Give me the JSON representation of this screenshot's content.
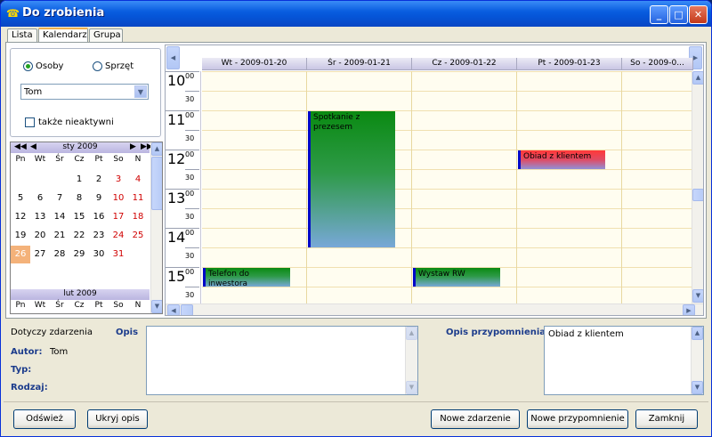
{
  "window": {
    "title": "Do zrobienia",
    "min": "_",
    "max": "□",
    "close": "✕"
  },
  "tabs": [
    {
      "label": "Lista"
    },
    {
      "label": "Kalendarz"
    },
    {
      "label": "Grupa"
    }
  ],
  "filter": {
    "radio_osoby": "Osoby",
    "radio_sprzet": "Sprzęt",
    "person_selected": "Tom",
    "inactive_label": "także nieaktywni"
  },
  "calendar": {
    "month1": "sty 2009",
    "month2": "lut 2009",
    "weekdays": [
      "Pn",
      "Wt",
      "Śr",
      "Cz",
      "Pt",
      "So",
      "N"
    ],
    "weeks": [
      [
        "",
        "",
        "",
        "1",
        "2",
        "3",
        "4"
      ],
      [
        "5",
        "6",
        "7",
        "8",
        "9",
        "10",
        "11"
      ],
      [
        "12",
        "13",
        "14",
        "15",
        "16",
        "17",
        "18"
      ],
      [
        "19",
        "20",
        "21",
        "22",
        "23",
        "24",
        "25"
      ],
      [
        "26",
        "27",
        "28",
        "29",
        "30",
        "31",
        ""
      ]
    ],
    "today": "26"
  },
  "schedule": {
    "columns": [
      {
        "label": "Wt  -  2009-01-20"
      },
      {
        "label": "Śr  -  2009-01-21"
      },
      {
        "label": "Cz  -  2009-01-22"
      },
      {
        "label": "Pt  -  2009-01-23"
      },
      {
        "label": "So  -  2009-0..."
      }
    ],
    "hours": [
      "10",
      "11",
      "12",
      "13",
      "14",
      "15"
    ],
    "minute_00": "00",
    "minute_30": "30",
    "events": [
      {
        "title": "Spotkanie z prezesem",
        "day": 1,
        "start": "11:00",
        "end": "14:30",
        "color": "green"
      },
      {
        "title": "Obiad z klientem",
        "day": 3,
        "start": "12:00",
        "end": "12:30",
        "color": "red"
      },
      {
        "title": "Telefon do inwestora",
        "day": 0,
        "start": "15:00",
        "end": "15:30",
        "color": "green"
      },
      {
        "title": "Wystaw RW",
        "day": 2,
        "start": "15:00",
        "end": "15:30",
        "color": "green"
      }
    ]
  },
  "details": {
    "dotyczy": "Dotyczy zdarzenia",
    "opis": "Opis",
    "autor_label": "Autor:",
    "autor_value": "Tom",
    "typ_label": "Typ:",
    "rodzaj_label": "Rodzaj:",
    "opis_przyp": "Opis przypomnienia",
    "przyp_value": "Obiad z klientem"
  },
  "buttons": {
    "odswiez": "Odśwież",
    "ukryj": "Ukryj opis",
    "nowe_zdarzenie": "Nowe zdarzenie",
    "nowe_przyp": "Nowe przypomnienie",
    "zamknij": "Zamknij"
  }
}
